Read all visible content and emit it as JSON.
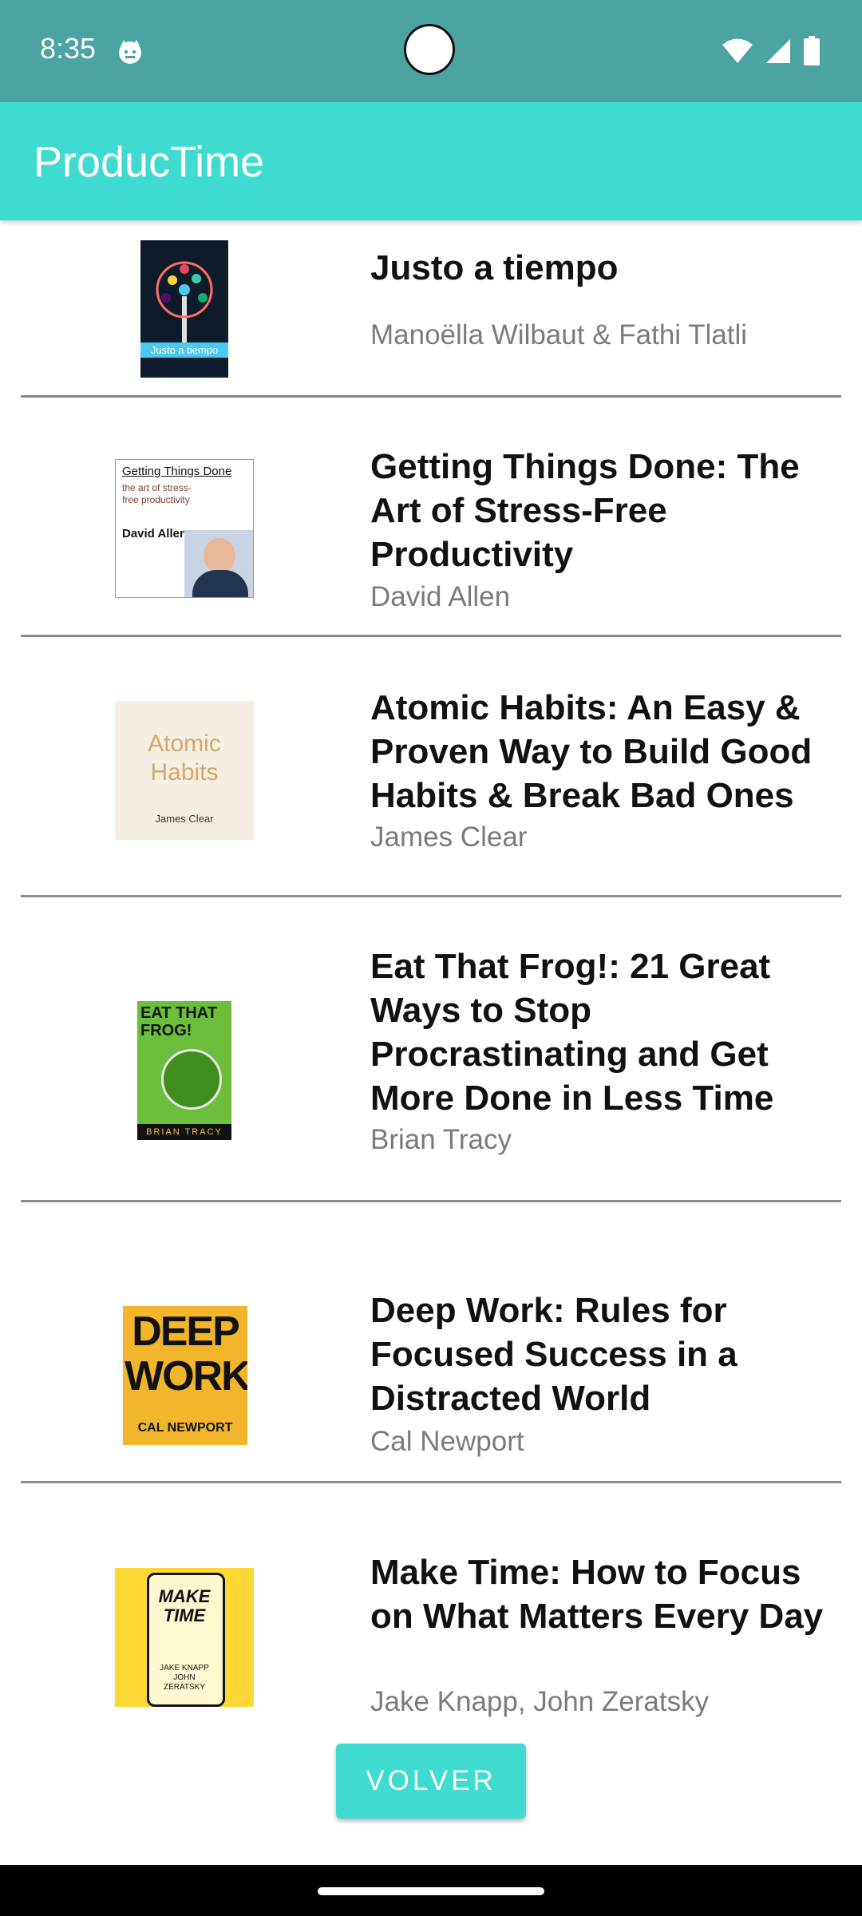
{
  "status_bar": {
    "time": "8:35"
  },
  "app_bar": {
    "title": "ProducTime"
  },
  "books": [
    {
      "title": "Justo a tiempo",
      "author": "Manoëlla Wilbaut & Fathi Tlatli",
      "cover_text": "Justo a tiempo"
    },
    {
      "title": "Getting Things Done: The Art of Stress-Free Productivity",
      "author": "David Allen",
      "cover_text": "Getting Things Done",
      "cover_sub": "the art of stress-free productivity",
      "cover_author": "David Allen"
    },
    {
      "title": "Atomic Habits: An Easy & Proven Way to Build Good Habits & Break Bad Ones",
      "author": "James Clear",
      "cover_text": "Atomic Habits",
      "cover_author": "James Clear"
    },
    {
      "title": "Eat That Frog!: 21 Great Ways to Stop Procrastinating and Get More Done in Less Time",
      "author": "Brian Tracy",
      "cover_text": "EAT THAT FROG!",
      "cover_author": "BRIAN TRACY"
    },
    {
      "title": "Deep Work: Rules for Focused Success in a Distracted World",
      "author": "Cal Newport",
      "cover_text": "DEEP WORK",
      "cover_author": "CAL NEWPORT"
    },
    {
      "title": "Make Time: How to Focus on What Matters Every Day",
      "author": "Jake Knapp, John Zeratsky",
      "cover_text": "MAKE TIME",
      "cover_author": "JAKE KNAPP JOHN ZERATSKY"
    }
  ],
  "back_button": {
    "label": "VOLVER"
  },
  "colors": {
    "accent": "#40dbd0",
    "status_bar": "#4ba3a2"
  },
  "icons": [
    "cat-notification-icon",
    "wifi-icon",
    "signal-icon",
    "battery-icon"
  ]
}
